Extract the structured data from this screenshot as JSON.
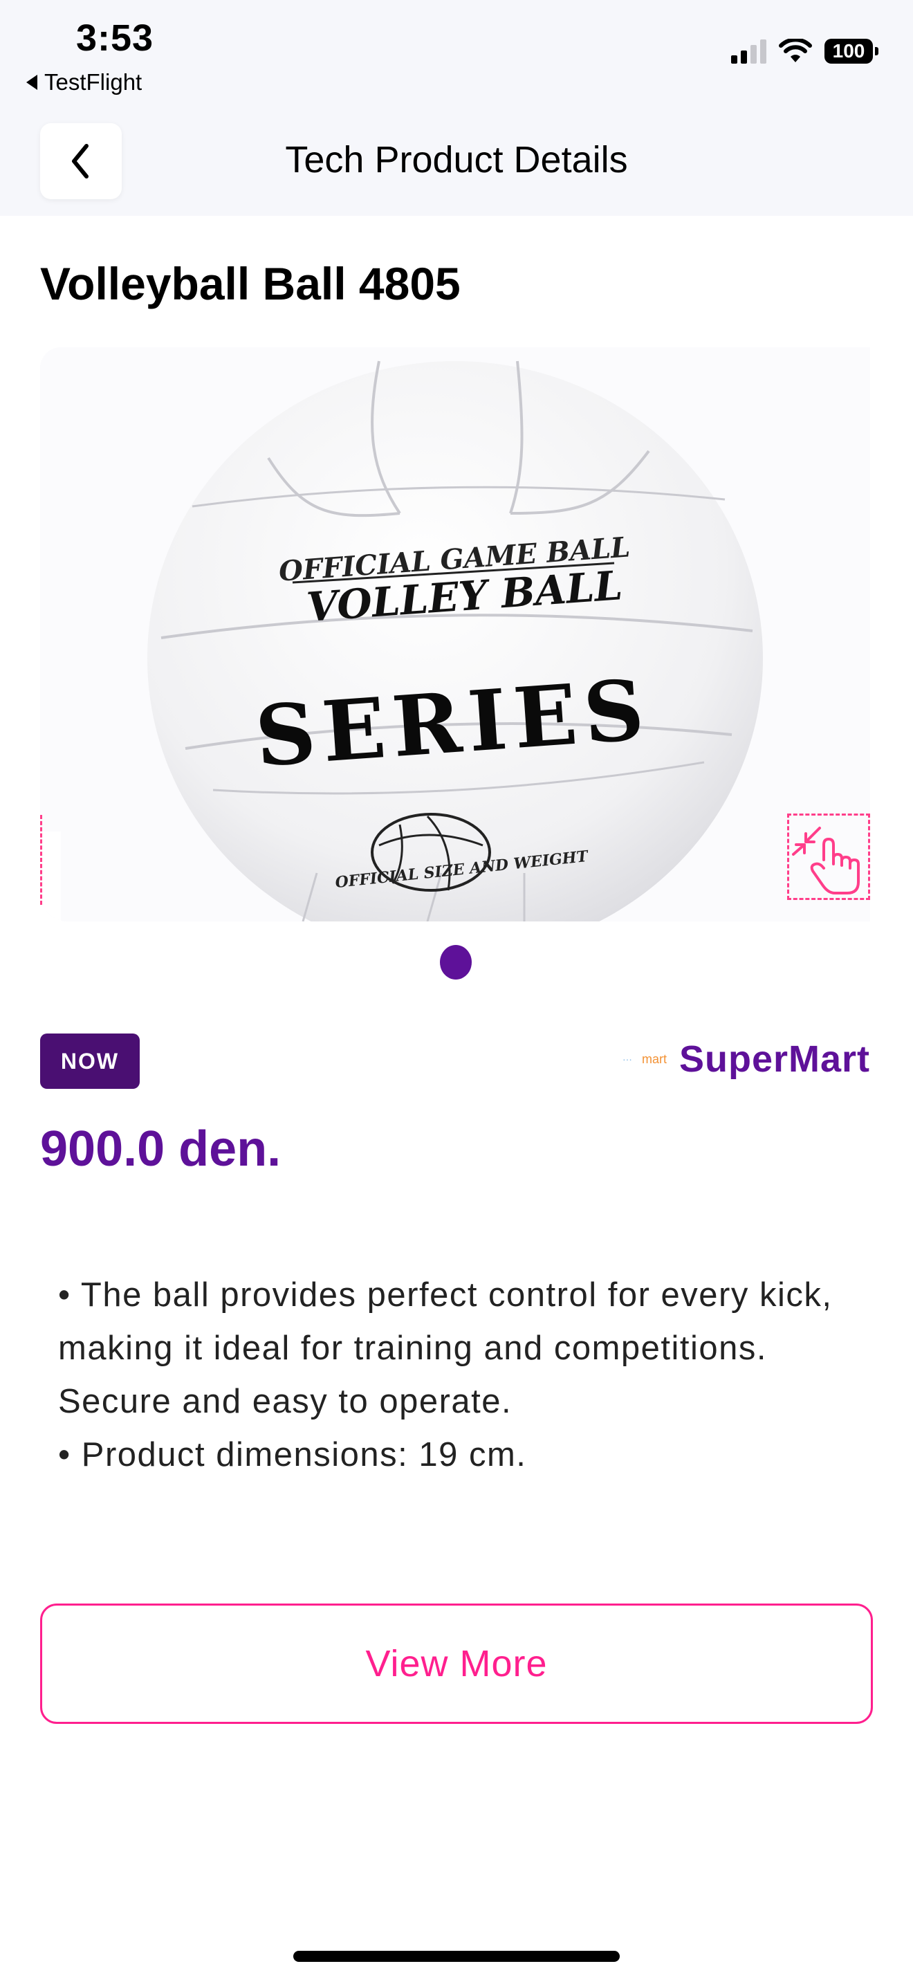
{
  "status_bar": {
    "time": "3:53",
    "back_app_label": "TestFlight",
    "battery": "100",
    "signal_icon": "signal-icon",
    "wifi_icon": "wifi-icon",
    "battery_icon": "battery-icon"
  },
  "header": {
    "title": "Tech Product Details",
    "back_icon": "chevron-left-icon"
  },
  "product": {
    "title": "Volleyball Ball 4805",
    "image_texts": {
      "line1": "OFFICIAL GAME BALL",
      "line2": "VOLLEY BALL",
      "line3": "SERIES",
      "line4": "OFFICIAL SIZE AND WEIGHT"
    },
    "carousel_index": 1,
    "carousel_count": 1,
    "badge": "NOW",
    "store_logo_text": "mart",
    "store_name": "SuperMart",
    "price": "900.0 den.",
    "description": [
      "• The ball provides perfect control for every kick, making it ideal for training and competitions. Secure and easy to operate.",
      "• Product dimensions: 19 cm."
    ],
    "view_more_label": "View More"
  },
  "colors": {
    "accent_purple": "#5e1199",
    "badge_purple": "#4a0f72",
    "button_pink": "#ff1f8e",
    "dashed_pink": "#ff3e8a"
  },
  "zoom_hint_icon": "pinch-zoom-icon"
}
